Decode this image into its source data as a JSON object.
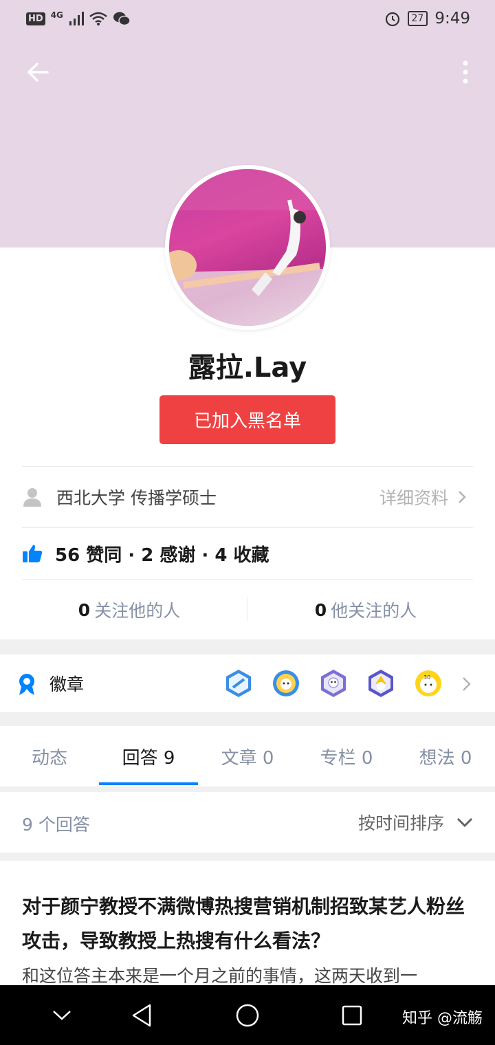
{
  "status_bar": {
    "network_badge": "HD",
    "network_type": "4G",
    "battery": "27",
    "time": "9:49"
  },
  "profile": {
    "name": "露拉.Lay",
    "blacklist_label": "已加入黑名单",
    "education": "西北大学 传播学硕士",
    "detail_label": "详细资料",
    "stats": "56 赞同 · 2 感谢 · 4 收藏",
    "followers_count": "0",
    "followers_label": "关注他的人",
    "following_count": "0",
    "following_label": "他关注的人"
  },
  "badges": {
    "title": "徽章",
    "icons": [
      "badge-icon-1",
      "badge-icon-2",
      "badge-icon-3",
      "badge-icon-4",
      "badge-icon-5"
    ]
  },
  "tabs": [
    {
      "label": "动态"
    },
    {
      "label": "回答 9"
    },
    {
      "label": "文章 0"
    },
    {
      "label": "专栏 0"
    },
    {
      "label": "想法 0"
    }
  ],
  "list": {
    "count_label": "9 个回答",
    "sort_label": "按时间排序"
  },
  "answer": {
    "title": "对于颜宁教授不满微博热搜营销机制招致某艺人粉丝攻击，导致教授上热搜有什么看法？",
    "excerpt": "和这位答主本来是一个月之前的事情，这两天收到一"
  },
  "watermark": "知乎 @流觞",
  "colors": {
    "cover": "#e6d6e6",
    "accent": "#0084ff",
    "blacklist": "#f04142"
  }
}
